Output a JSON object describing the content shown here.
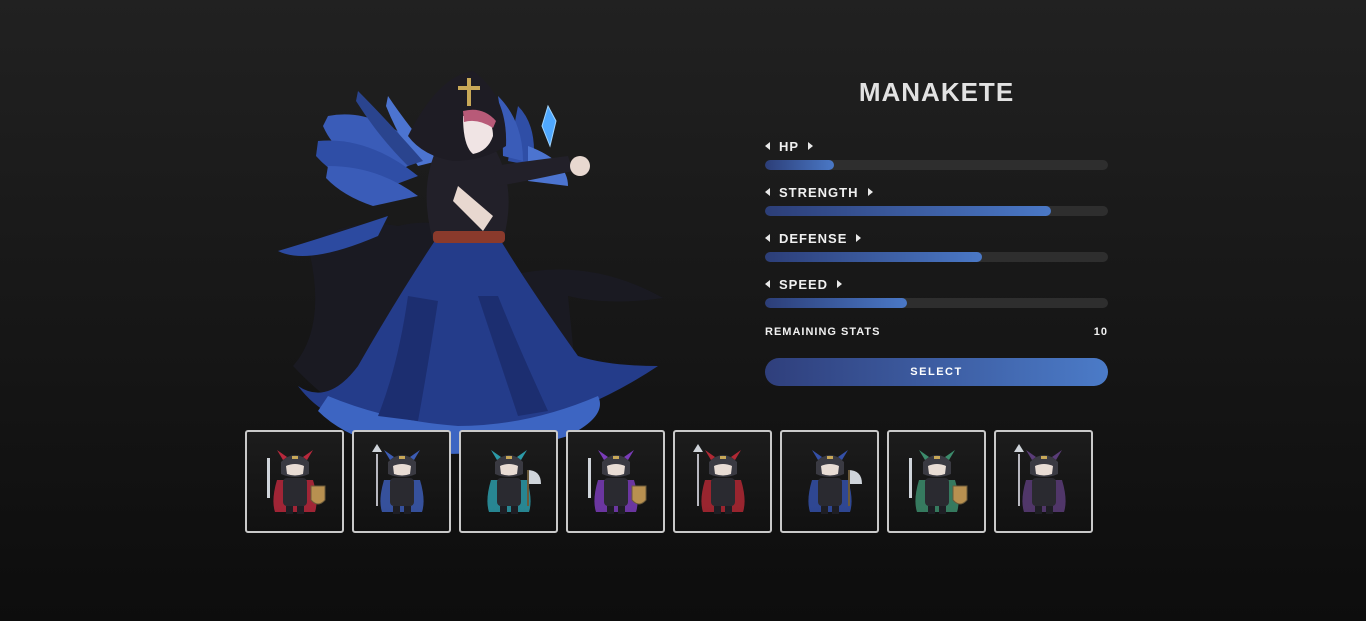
{
  "character": {
    "name": "MANAKETE",
    "portrait_icon": "hooded-raven-mage-portrait"
  },
  "stats": [
    {
      "label": "HP",
      "level": 0.2
    },
    {
      "label": "STRENGTH",
      "level": 0.835
    },
    {
      "label": "DEFENSE",
      "level": 0.633
    },
    {
      "label": "SPEED",
      "level": 0.415
    }
  ],
  "remaining": {
    "label": "REMAINING STATS",
    "value": "10"
  },
  "select_label": "SELECT",
  "roster": [
    {
      "icon": "red-sword-knight-sprite",
      "accent": "#b8283c"
    },
    {
      "icon": "blue-spear-knight-sprite",
      "accent": "#3c5cb4"
    },
    {
      "icon": "teal-axe-knight-sprite",
      "accent": "#2c9aa8"
    },
    {
      "icon": "purple-archer-sprite",
      "accent": "#7a3cb8"
    },
    {
      "icon": "red-tome-mage-sprite",
      "accent": "#b02834"
    },
    {
      "icon": "blue-hooded-mage-sprite",
      "accent": "#3450a8"
    },
    {
      "icon": "green-axe-warrior-sprite",
      "accent": "#3c8c6c"
    },
    {
      "icon": "purple-rogue-sprite",
      "accent": "#5a3c78"
    }
  ]
}
